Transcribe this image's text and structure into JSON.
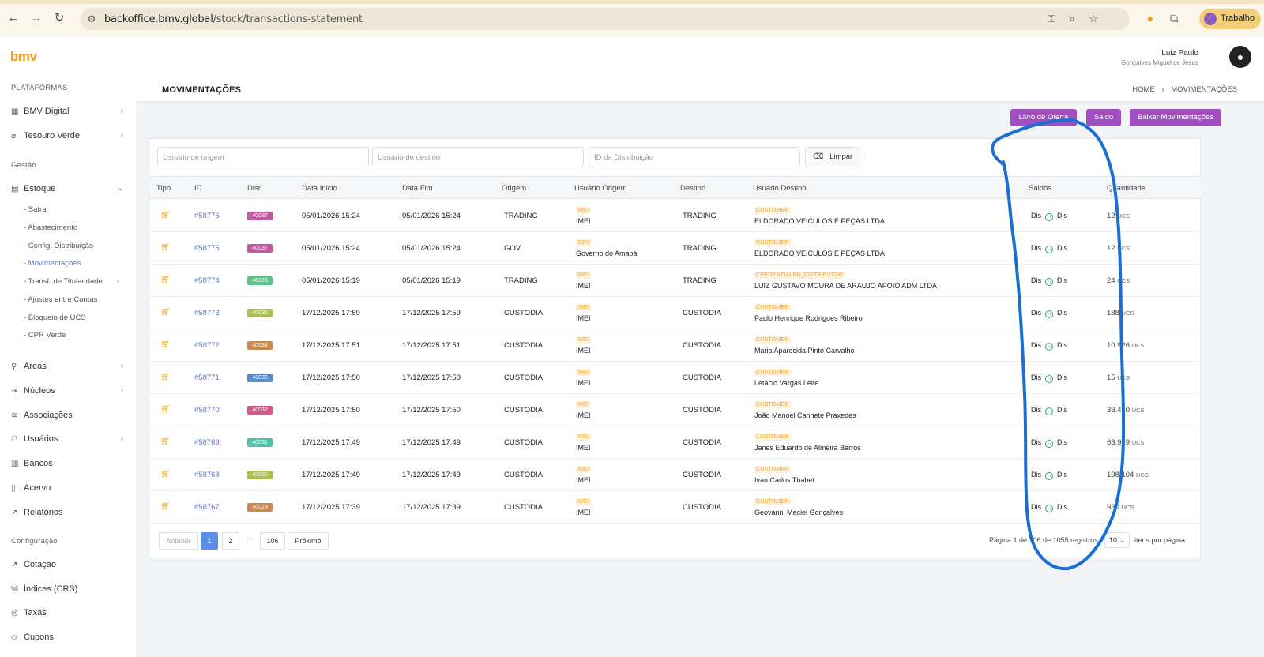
{
  "browser": {
    "url_host": "backoffice.bmv.global",
    "url_path": "/stock/transactions-statement",
    "profile_label": "Trabalho",
    "profile_initial": "L"
  },
  "app": {
    "logo": "bmv",
    "user_name": "Luiz Paulo",
    "user_sub": "Gonçalves Miguel de Jesus"
  },
  "sidebar": {
    "section_platforms": "PLATAFORMAS",
    "section_gestao": "Gestão",
    "section_config": "Configuração",
    "platforms": [
      "BMV Digital",
      "Tesouro Verde"
    ],
    "estoque": "Estoque",
    "estoque_subs": [
      "- Safra",
      "- Abastecimento",
      "- Config. Distribuição",
      "- Movimentações",
      "- Transf. de Titularidade",
      "- Ajustes entre Contas",
      "- Bloqueio de UCS",
      "- CPR Verde"
    ],
    "gestao_items": [
      "Areas",
      "Núcleos",
      "Associações",
      "Usuários",
      "Bancos",
      "Acervo",
      "Relatórios"
    ],
    "config_items": [
      "Cotação",
      "Índices (CRS)",
      "Taxas",
      "Cupons"
    ]
  },
  "page": {
    "title": "MOVIMENTAÇÕES",
    "breadcrumb_home": "HOME",
    "breadcrumb_sep": "›",
    "breadcrumb_current": "MOVIMENTAÇÕES",
    "btn_livro": "Livro de Oferta",
    "btn_saldo": "Saldo",
    "btn_baixar": "Baixar Movimentações"
  },
  "filters": {
    "origem_placeholder": "Usuário de origem",
    "destino_placeholder": "Usuário de destino",
    "dist_placeholder": "ID da Distribuição",
    "clear_label": "Limpar"
  },
  "table": {
    "headers": [
      "Tipo",
      "ID",
      "Dist",
      "Data Inicio",
      "Data Fim",
      "Origem",
      "Usuário Origem",
      "Destino",
      "Usuário Destino",
      "Saldos",
      "Quantidade"
    ],
    "saldo_label": "Dis",
    "unit": "UCS",
    "rows": [
      {
        "id": "#58776",
        "dist": "40037",
        "dist_color": "#c05aa0",
        "inicio": "05/01/2026 15:24",
        "fim": "05/01/2026 15:24",
        "origem": "TRADING",
        "uo_tag": "IMEI",
        "uo_name": "IMEI",
        "destino": "TRADING",
        "ud_tag": "CUSTOMER",
        "ud_name": "ELDORADO VEICULOS E PEÇAS LTDA",
        "qty": "12"
      },
      {
        "id": "#58775",
        "dist": "40037",
        "dist_color": "#c05aa0",
        "inicio": "05/01/2026 15:24",
        "fim": "05/01/2026 15:24",
        "origem": "GOV",
        "uo_tag": "GOV",
        "uo_name": "Governo do Amapá",
        "destino": "TRADING",
        "ud_tag": "CUSTOMER",
        "ud_name": "ELDORADO VEICULOS E PEÇAS LTDA",
        "qty": "12"
      },
      {
        "id": "#58774",
        "dist": "40036",
        "dist_color": "#5cc48a",
        "inicio": "05/01/2026 15:19",
        "fim": "05/01/2026 15:19",
        "origem": "TRADING",
        "uo_tag": "IMEI",
        "uo_name": "IMEI",
        "destino": "TRADING",
        "ud_tag": "CREDENTIALED_DISTRIBUTOR",
        "ud_name": "LUIZ GUSTAVO MOURA DE ARAUJO APOIO ADM LTDA",
        "qty": "24"
      },
      {
        "id": "#58773",
        "dist": "40035",
        "dist_color": "#a8c050",
        "inicio": "17/12/2025 17:59",
        "fim": "17/12/2025 17:59",
        "origem": "CUSTODIA",
        "uo_tag": "IMEI",
        "uo_name": "IMEI",
        "destino": "CUSTODIA",
        "ud_tag": "CUSTOMER",
        "ud_name": "Paulo Henrique Rodrigues Ribeiro",
        "qty": "188"
      },
      {
        "id": "#58772",
        "dist": "40034",
        "dist_color": "#c98a50",
        "inicio": "17/12/2025 17:51",
        "fim": "17/12/2025 17:51",
        "origem": "CUSTODIA",
        "uo_tag": "IMEI",
        "uo_name": "IMEI",
        "destino": "CUSTODIA",
        "ud_tag": "CUSTOMER",
        "ud_name": "Maria Aparecida Pinto Carvalho",
        "qty": "10.926"
      },
      {
        "id": "#58771",
        "dist": "40033",
        "dist_color": "#5a8ad0",
        "inicio": "17/12/2025 17:50",
        "fim": "17/12/2025 17:50",
        "origem": "CUSTODIA",
        "uo_tag": "IMEI",
        "uo_name": "IMEI",
        "destino": "CUSTODIA",
        "ud_tag": "CUSTOMER",
        "ud_name": "Letacio Vargas Leite",
        "qty": "15"
      },
      {
        "id": "#58770",
        "dist": "40032",
        "dist_color": "#d05a8a",
        "inicio": "17/12/2025 17:50",
        "fim": "17/12/2025 17:50",
        "origem": "CUSTODIA",
        "uo_tag": "IMEI",
        "uo_name": "IMEI",
        "destino": "CUSTODIA",
        "ud_tag": "CUSTOMER",
        "ud_name": "João Manoel Canhete Praxedes",
        "qty": "33.440"
      },
      {
        "id": "#58769",
        "dist": "40031",
        "dist_color": "#50c0a8",
        "inicio": "17/12/2025 17:49",
        "fim": "17/12/2025 17:49",
        "origem": "CUSTODIA",
        "uo_tag": "IMEI",
        "uo_name": "IMEI",
        "destino": "CUSTODIA",
        "ud_tag": "CUSTOMER",
        "ud_name": "Janes Eduardo de Almeira Barros",
        "qty": "63.919"
      },
      {
        "id": "#58768",
        "dist": "40030",
        "dist_color": "#a8c050",
        "inicio": "17/12/2025 17:49",
        "fim": "17/12/2025 17:49",
        "origem": "CUSTODIA",
        "uo_tag": "IMEI",
        "uo_name": "IMEI",
        "destino": "CUSTODIA",
        "ud_tag": "CUSTOMER",
        "ud_name": "Ivan Carlos Thabet",
        "qty": "198.104"
      },
      {
        "id": "#58767",
        "dist": "40029",
        "dist_color": "#c98a50",
        "inicio": "17/12/2025 17:39",
        "fim": "17/12/2025 17:39",
        "origem": "CUSTODIA",
        "uo_tag": "IMEI",
        "uo_name": "IMEI",
        "destino": "CUSTODIA",
        "ud_tag": "CUSTOMER",
        "ud_name": "Geovanni Maciel Gonçalves",
        "qty": "930"
      }
    ]
  },
  "pagination": {
    "prev": "Anterior",
    "pages": [
      "1",
      "2",
      "...",
      "106"
    ],
    "next": "Próximo",
    "info": "Página 1 de 106 de 1055 registros",
    "per_page": "10",
    "per_page_label": "itens por página"
  },
  "colors": {
    "accent": "#a04fc0",
    "brand": "#f39a1e",
    "annotation": "#1a6fd1"
  }
}
